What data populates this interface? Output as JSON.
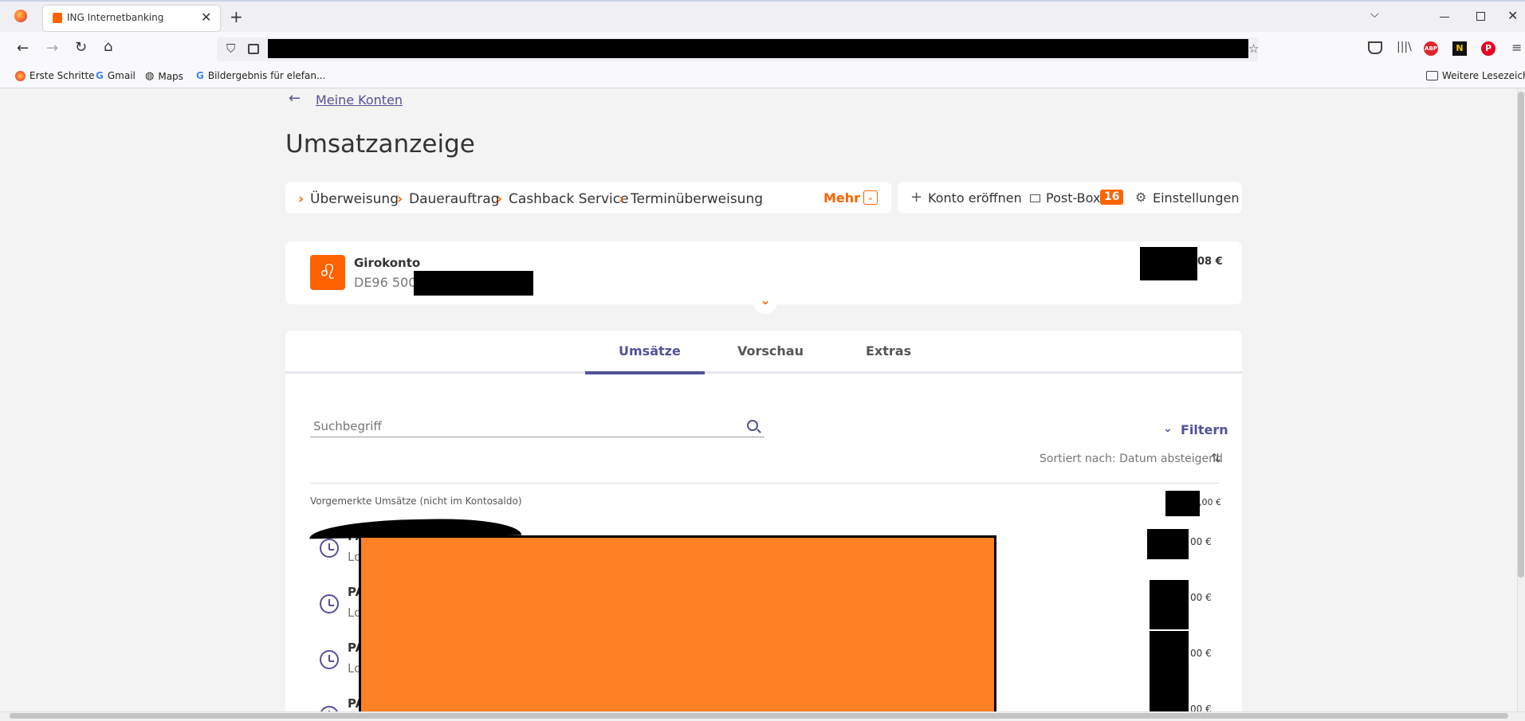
{
  "browser": {
    "tab_title": "ING Internetbanking",
    "bookmarks": [
      "Erste Schritte",
      "Gmail",
      "Maps",
      "Bildergebnis für elefan..."
    ],
    "other_bookmarks": "Weitere Lesezeich"
  },
  "page": {
    "back_link": "Meine Konten",
    "title": "Umsatzanzeige",
    "quick_links": [
      "Überweisung",
      "Dauerauftrag",
      "Cashback Service",
      "Terminüberweisung"
    ],
    "more_label": "Mehr",
    "actions": {
      "open_account": "Konto eröffnen",
      "postbox": "Post-Box",
      "postbox_count": "16",
      "settings": "Einstellungen"
    },
    "account": {
      "name": "Girokonto",
      "iban_prefix": "DE96 5001",
      "balance_suffix": "08 €"
    },
    "tabs": [
      "Umsätze",
      "Vorschau",
      "Extras"
    ],
    "active_tab": "Umsätze",
    "search_placeholder": "Suchbegriff",
    "filter_label": "Filtern",
    "sort_label": "Sortiert nach: Datum absteigend",
    "pending_label": "Vorgemerkte Umsätze (nicht im Kontosaldo)",
    "pending_total_suffix": ",00 €",
    "transactions": [
      {
        "name": "PA",
        "sub": "Lo",
        "amount_suffix": "00 €"
      },
      {
        "name": "PA",
        "sub": "Lo",
        "amount_suffix": "00 €"
      },
      {
        "name": "PA",
        "sub": "Lo",
        "amount_suffix": "00 €"
      },
      {
        "name": "PA",
        "sub": "",
        "amount_suffix": "00 €"
      }
    ]
  },
  "colors": {
    "brand_orange": "#ff6200",
    "link_purple": "#525199",
    "redaction_orange": "#ff8126"
  }
}
